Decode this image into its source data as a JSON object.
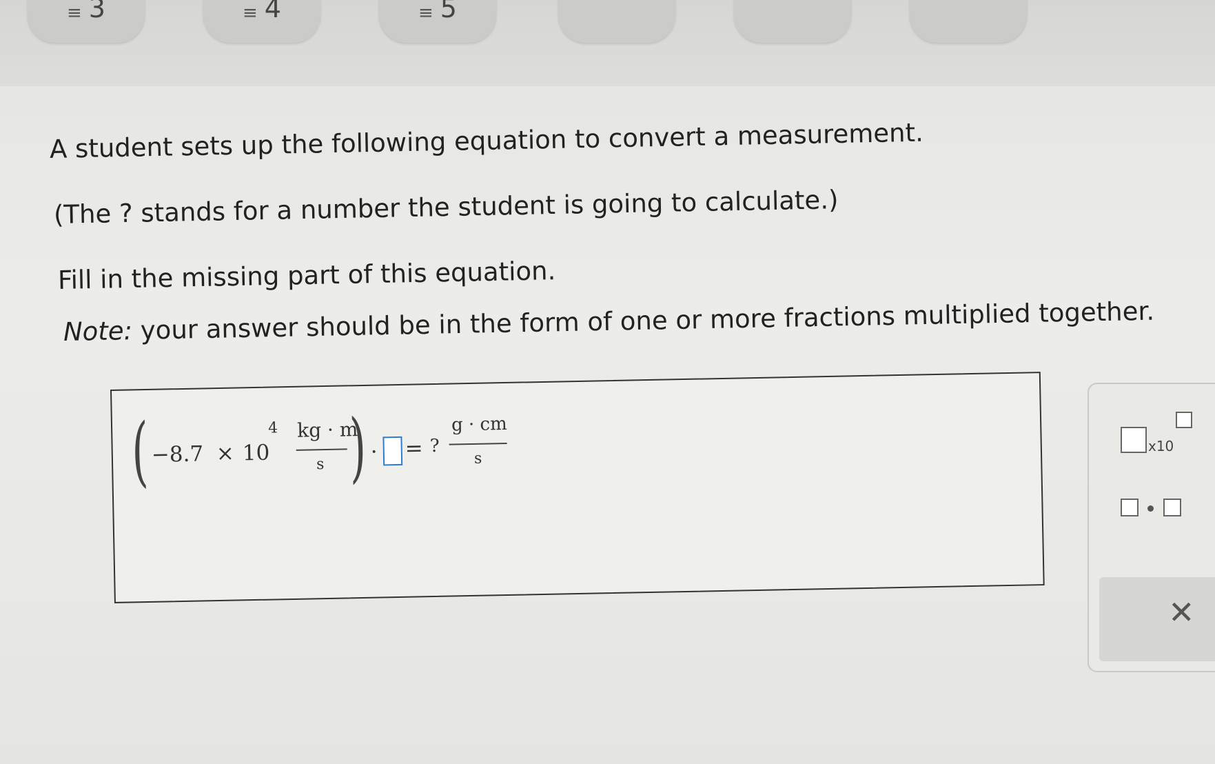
{
  "tabs": [
    {
      "label": "3",
      "icon": "list-icon"
    },
    {
      "label": "4",
      "icon": "list-icon"
    },
    {
      "label": "5",
      "icon": "list-icon"
    }
  ],
  "question": {
    "line1": "A student sets up the following equation to convert a measurement.",
    "line2": "(The ? stands for a number the student is going to calculate.)",
    "line3": "Fill in the missing part of this equation.",
    "note_label": "Note:",
    "note_text": " your answer should be in the form of one or more fractions multiplied together."
  },
  "equation": {
    "coefficient": "−8.7",
    "times": "×",
    "base": "10",
    "exponent": "4",
    "left_numerator": "kg · m",
    "left_denominator": "s",
    "dot": "·",
    "equals": "=",
    "unknown": "?",
    "right_numerator": "g · cm",
    "right_denominator": "s"
  },
  "palette": {
    "x10_label": "x10",
    "clear_symbol": "✕"
  }
}
